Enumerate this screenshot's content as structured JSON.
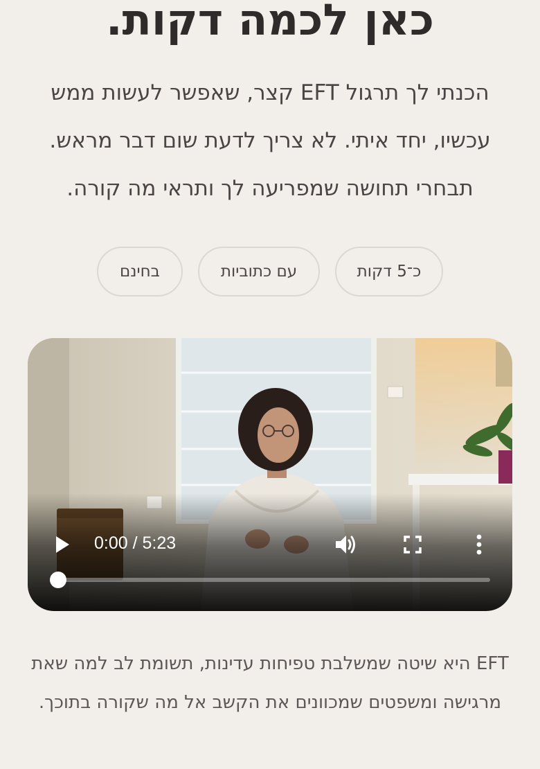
{
  "page": {
    "headline": "כאן לכמה דקות.",
    "intro": "הכנתי לך תרגול EFT קצר, שאפשר לעשות ממש עכשיו, יחד איתי. לא צריך לדעת שום דבר מראש. תבחרי תחושה שמפריעה לך ותראי מה קורה.",
    "description": "EFT היא שיטה שמשלבת טפיחות עדינות, תשומת לב למה שאת מרגישה ומשפטים שמכוונים את הקשב אל מה שקורה בתוכך."
  },
  "chips": [
    {
      "label": "כ־5 דקות"
    },
    {
      "label": "עם כתוביות"
    },
    {
      "label": "בחינם"
    }
  ],
  "video": {
    "current_time": "0:00",
    "duration": "5:23",
    "time_display": "0:00 / 5:23",
    "progress_fraction": 0.0,
    "icons": {
      "play": "play-icon",
      "volume": "volume-icon",
      "fullscreen": "fullscreen-icon",
      "more": "more-vertical-icon"
    }
  },
  "colors": {
    "background": "#f2efeb",
    "text_dark": "#2f2b2b",
    "text_body": "#4a4444",
    "chip_border": "#ddd8cf"
  }
}
